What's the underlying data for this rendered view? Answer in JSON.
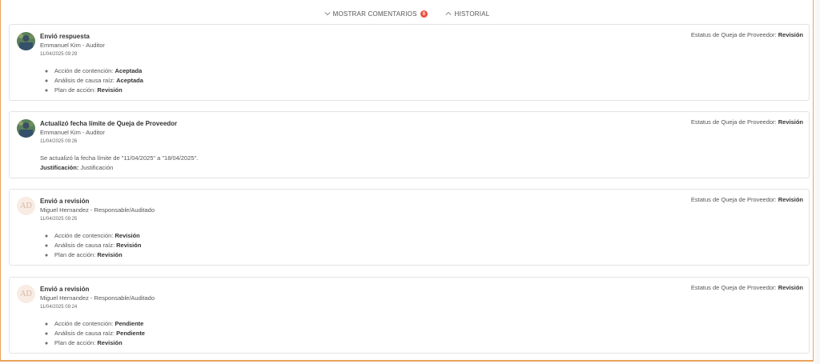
{
  "topbar": {
    "comments_label": "MOSTRAR COMENTARIOS",
    "comments_count": "0",
    "history_label": "HISTORIAL"
  },
  "entries": [
    {
      "title": "Envió respuesta",
      "user": "Emmanuel Kim - Auditor",
      "time": "11/04/2025 09:29",
      "status_label": "Estatus de Queja de Proveedor:",
      "status_value": "Revisión",
      "items": [
        {
          "label": "Acción de contención:",
          "value": "Aceptada"
        },
        {
          "label": "Análisis de causa raíz:",
          "value": "Aceptada"
        },
        {
          "label": "Plan de acción:",
          "value": "Revisión"
        }
      ]
    },
    {
      "title": "Actualizó fecha límite de Queja de Proveedor",
      "user": "Emmanuel Kim - Auditor",
      "time": "11/04/2025 09:26",
      "status_label": "Estatus de Queja de Proveedor:",
      "status_value": "Revisión",
      "text": "Se actualizó la fecha límite de \"11/04/2025\" a \"18/04/2025\".",
      "justification_label": "Justificación:",
      "justification_value": "Justificación"
    },
    {
      "initials": "AD",
      "title": "Envió a revisión",
      "user": "Miguel Hernandez - Responsable/Auditado",
      "time": "11/04/2025 09:25",
      "status_label": "Estatus de Queja de Proveedor:",
      "status_value": "Revisión",
      "items": [
        {
          "label": "Acción de contención:",
          "value": "Revisión"
        },
        {
          "label": "Análisis de causa raíz:",
          "value": "Revisión"
        },
        {
          "label": "Plan de acción:",
          "value": "Revisión"
        }
      ]
    },
    {
      "initials": "AD",
      "title": "Envió a revisión",
      "user": "Miguel Hernandez - Responsable/Auditado",
      "time": "11/04/2025 09:24",
      "status_label": "Estatus de Queja de Proveedor:",
      "status_value": "Revisión",
      "items": [
        {
          "label": "Acción de contención:",
          "value": "Pendiente"
        },
        {
          "label": "Análisis de causa raíz:",
          "value": "Pendiente"
        },
        {
          "label": "Plan de acción:",
          "value": "Revisión"
        }
      ]
    }
  ]
}
